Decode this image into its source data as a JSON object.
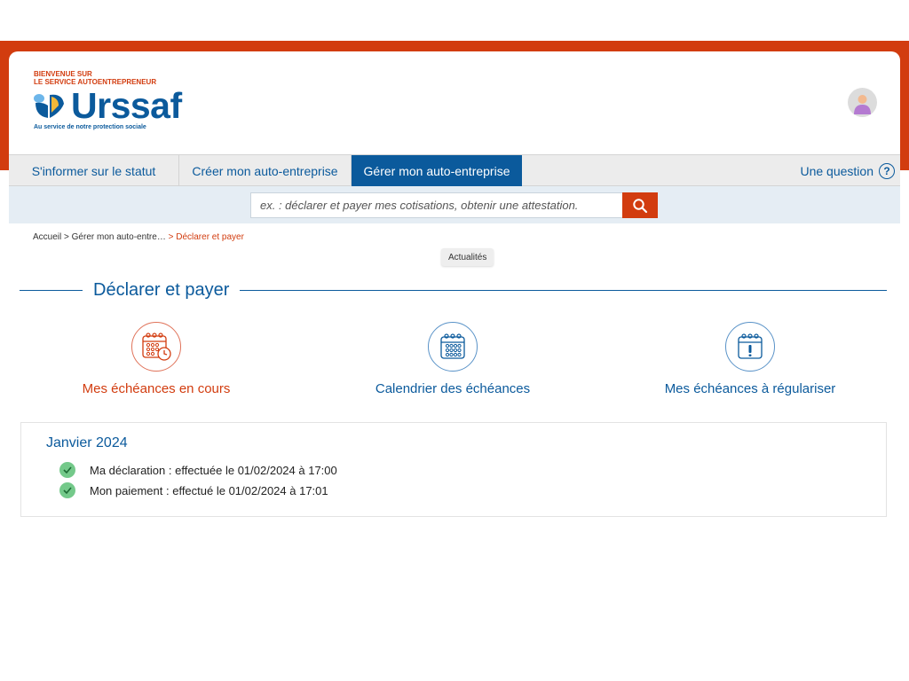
{
  "header": {
    "welcome_line1": "BIENVENUE SUR",
    "welcome_line2": "LE SERVICE AUTOENTREPRENEUR",
    "logo_text": "Urssaf",
    "tagline": "Au service de notre protection sociale",
    "brand_color": "#0b5a9c",
    "accent_color": "#d23c0f"
  },
  "nav": {
    "tabs": [
      {
        "label": "S'informer sur le statut"
      },
      {
        "label": "Créer mon auto-entreprise"
      },
      {
        "label": "Gérer mon auto-entreprise",
        "active": true
      }
    ],
    "question_label": "Une question",
    "question_icon": "?"
  },
  "search": {
    "placeholder": "ex. : déclarer et payer mes cotisations, obtenir une attestation.",
    "button_icon": "search-icon"
  },
  "breadcrumb": {
    "items": [
      "Accueil",
      "Gérer mon auto-entre…",
      "Déclarer et payer"
    ],
    "separator": ">"
  },
  "news_pill": "Actualités",
  "section": {
    "title": "Déclarer et payer",
    "options": [
      {
        "label": "Mes échéances en cours",
        "icon": "calendar-clock-icon"
      },
      {
        "label": "Calendrier des échéances",
        "icon": "calendar-icon"
      },
      {
        "label": "Mes échéances à régulariser",
        "icon": "calendar-alert-icon"
      }
    ]
  },
  "period": {
    "title": "Janvier 2024",
    "items": [
      {
        "text": "Ma déclaration : effectuée le 01/02/2024 à 17:00",
        "status": "done"
      },
      {
        "text": "Mon paiement : effectué le 01/02/2024 à 17:01",
        "status": "done"
      }
    ]
  }
}
